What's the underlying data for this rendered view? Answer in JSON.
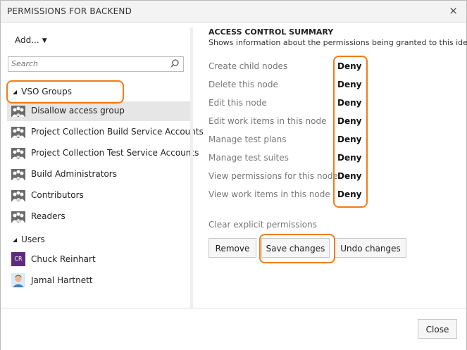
{
  "dialog": {
    "title": "PERMISSIONS FOR BACKEND",
    "close_glyph": "×"
  },
  "left": {
    "add_label": "Add...",
    "search_placeholder": "Search",
    "groups_header": "VSO Groups",
    "groups": [
      {
        "label": "Disallow access group",
        "selected": true
      },
      {
        "label": "Project Collection Build Service Accounts",
        "selected": false
      },
      {
        "label": "Project Collection Test Service Accounts",
        "selected": false
      },
      {
        "label": "Build Administrators",
        "selected": false
      },
      {
        "label": "Contributors",
        "selected": false
      },
      {
        "label": "Readers",
        "selected": false
      }
    ],
    "users_header": "Users",
    "users": [
      {
        "label": "Chuck Reinhart",
        "avatar_text": "CR"
      },
      {
        "label": "Jamal Hartnett",
        "avatar_text": ""
      }
    ]
  },
  "summary": {
    "title": "ACCESS CONTROL SUMMARY",
    "description": "Shows information about the permissions being granted to this identity",
    "permissions": [
      {
        "name": "Create child nodes",
        "value": "Deny"
      },
      {
        "name": "Delete this node",
        "value": "Deny"
      },
      {
        "name": "Edit this node",
        "value": "Deny"
      },
      {
        "name": "Edit work items in this node",
        "value": "Deny"
      },
      {
        "name": "Manage test plans",
        "value": "Deny"
      },
      {
        "name": "Manage test suites",
        "value": "Deny"
      },
      {
        "name": "View permissions for this node",
        "value": "Deny"
      },
      {
        "name": "View work items in this node",
        "value": "Deny"
      }
    ],
    "clear_label": "Clear explicit permissions",
    "buttons": {
      "remove": "Remove",
      "save": "Save changes",
      "undo": "Undo changes"
    }
  },
  "footer": {
    "close_label": "Close"
  },
  "colors": {
    "highlight": "#f07c1a",
    "selected_row": "#e6e6e6",
    "avatar_cr": "#5e2a7e"
  }
}
